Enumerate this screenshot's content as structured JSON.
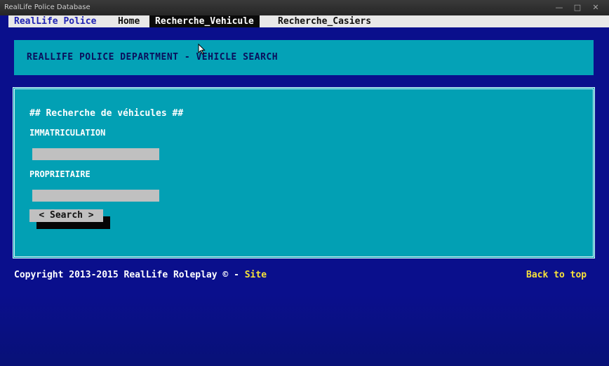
{
  "window": {
    "title": "RealLife Police Database",
    "minimize_glyph": "—",
    "maximize_glyph": "□",
    "close_glyph": "✕"
  },
  "nav": {
    "brand": "RealLife Police",
    "items": [
      {
        "label": "Home",
        "active": false
      },
      {
        "label": "Recherche_Vehicule",
        "active": true
      },
      {
        "label": "Recherche_Casiers",
        "active": false
      }
    ]
  },
  "header": {
    "text": "REALLIFE POLICE DEPARTMENT - VEHICLE SEARCH"
  },
  "form": {
    "section_title": "## Recherche de véhicules ##",
    "immatriculation_label": "IMMATRICULATION",
    "immatriculation_value": "",
    "proprietaire_label": "PROPRIETAIRE",
    "proprietaire_value": "",
    "search_button": "< Search >"
  },
  "footer": {
    "copyright": "Copyright 2013-2015 RealLife Roleplay © - ",
    "site_link": "Site",
    "back_to_top": "Back to top"
  },
  "colors": {
    "background": "#0a0f8c",
    "panel": "#02a0b4",
    "accent_link": "#f7e23a",
    "nav_active_bg": "#0a0a0a"
  }
}
